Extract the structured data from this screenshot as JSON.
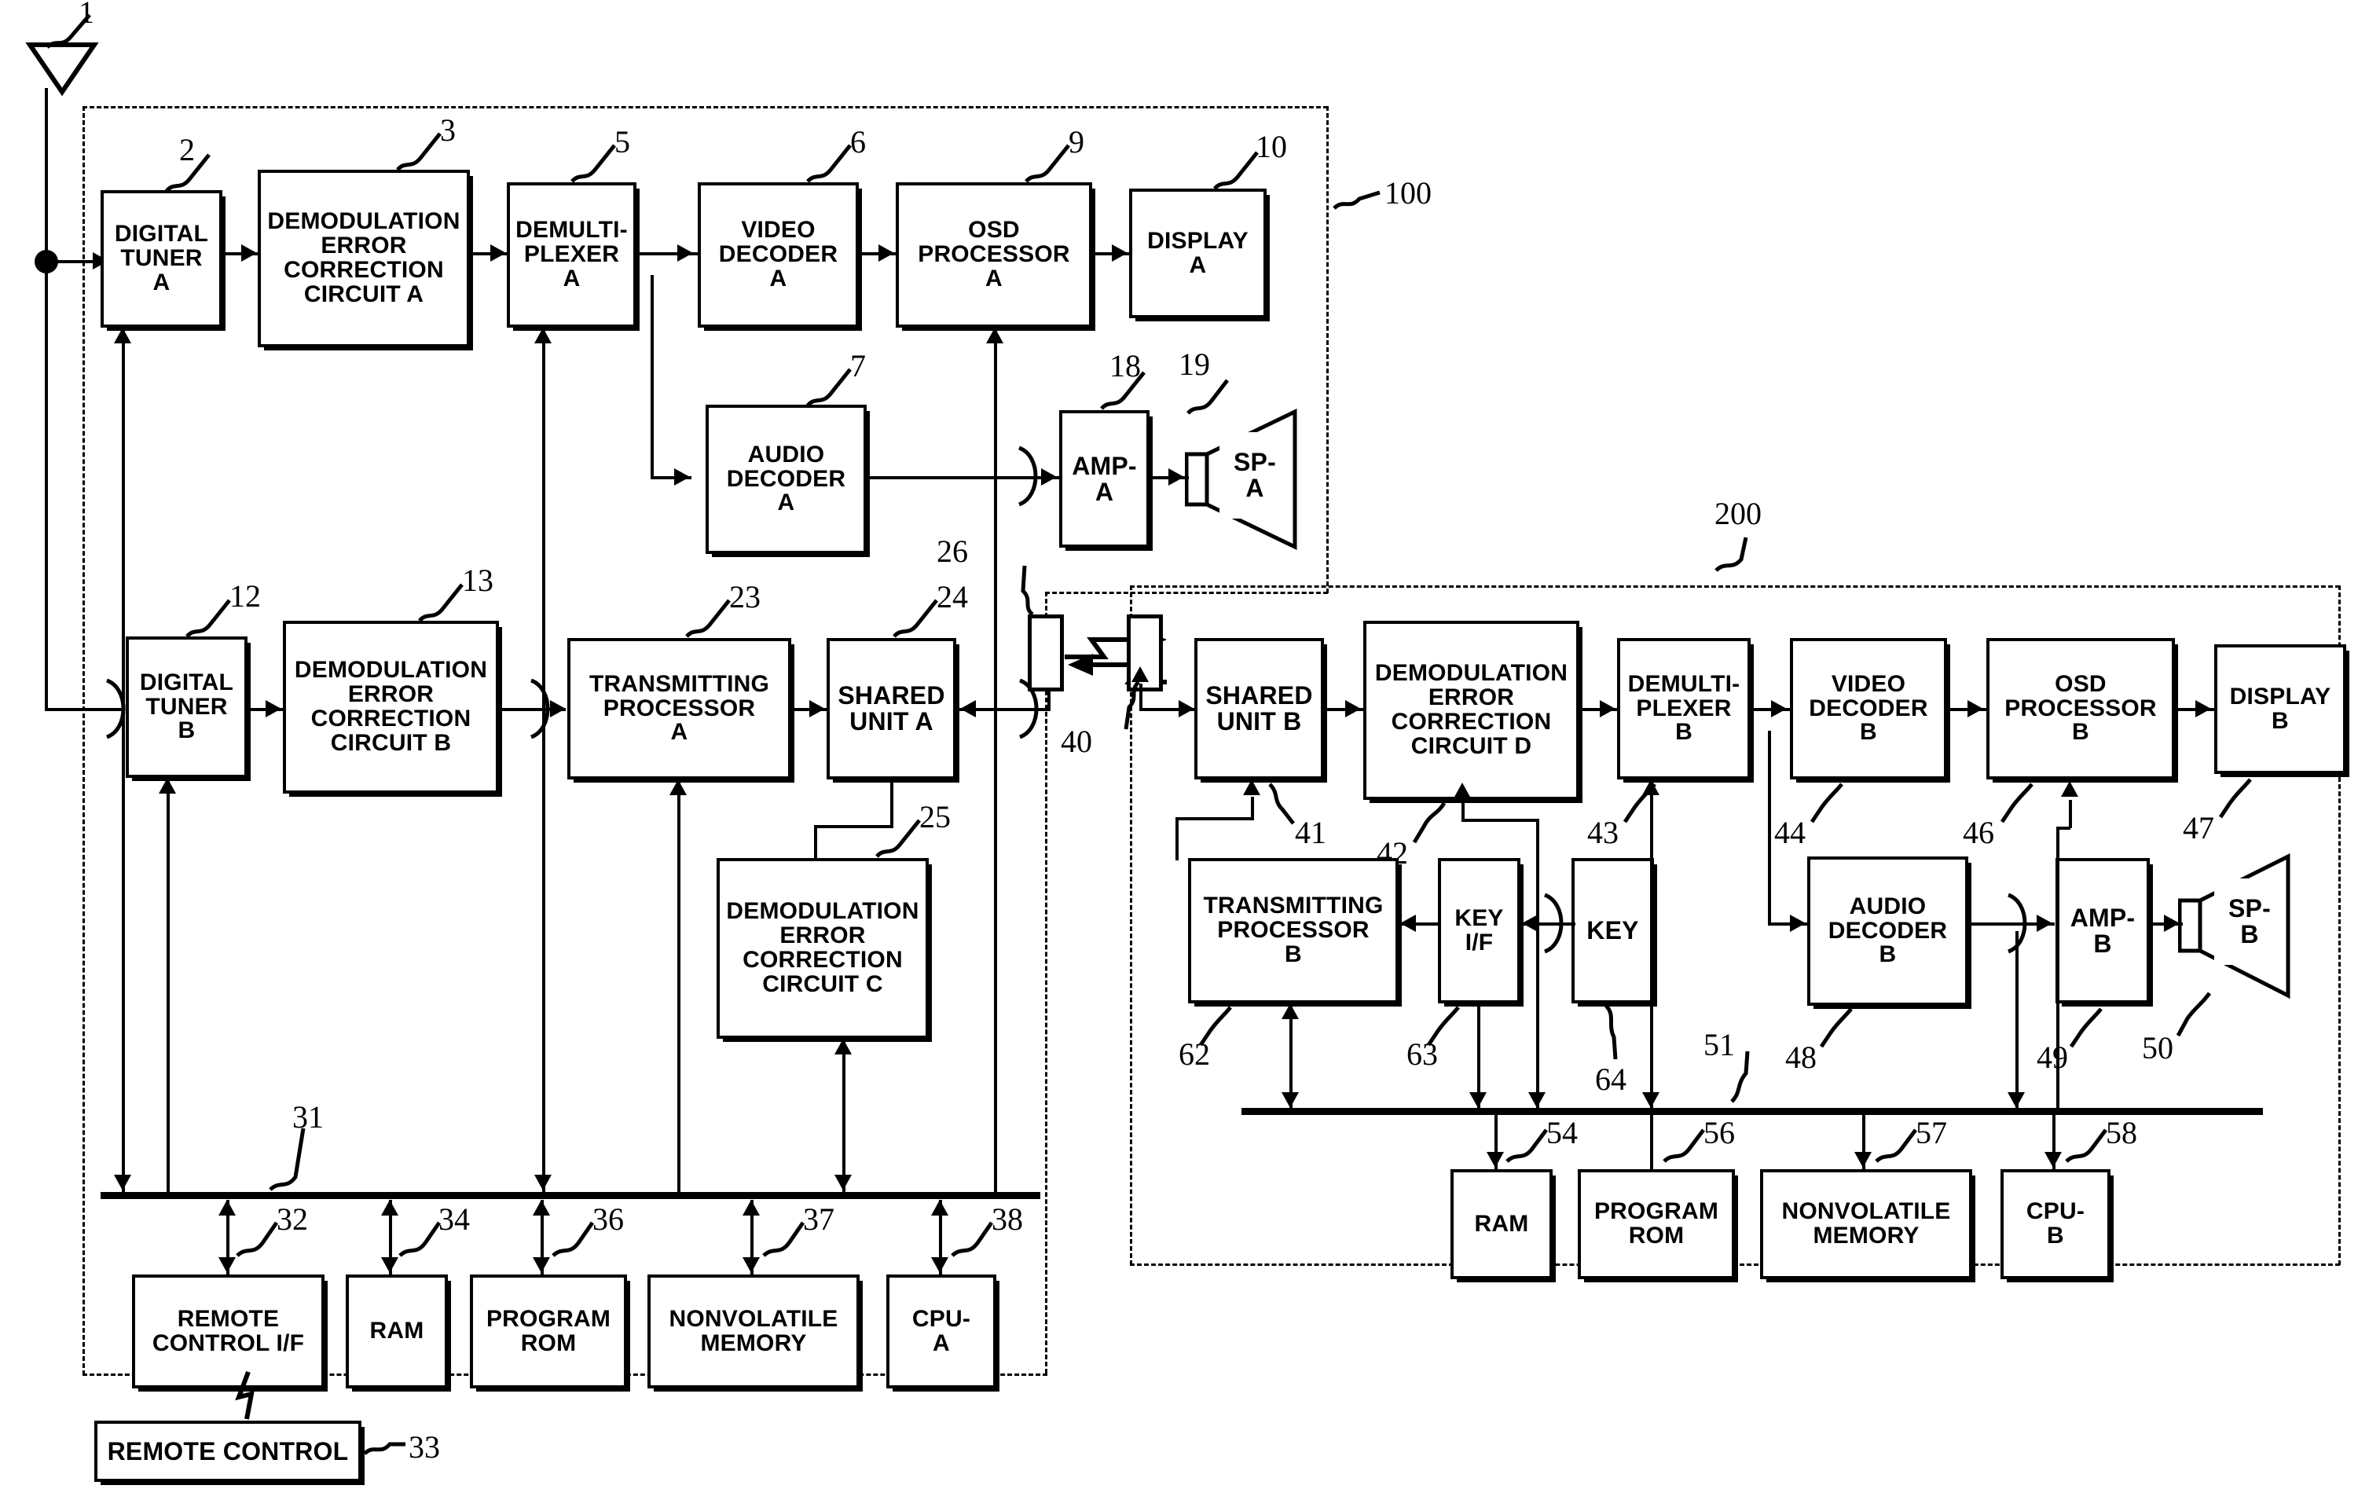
{
  "figure": {
    "type": "patent-block-diagram",
    "units": [
      {
        "ref": "100",
        "name": "main-unit"
      },
      {
        "ref": "200",
        "name": "sub-unit"
      }
    ]
  },
  "blocks": [
    {
      "id": "digital_tuner_a",
      "label": "DIGITAL\nTUNER\nA",
      "ref": "2"
    },
    {
      "id": "demod_a",
      "label": "DEMODULATION\nERROR\nCORRECTION\nCIRCUIT A",
      "ref": "3"
    },
    {
      "id": "demux_a",
      "label": "DEMULTI-\nPLEXER\nA",
      "ref": "5"
    },
    {
      "id": "video_decoder_a",
      "label": "VIDEO\nDECODER\nA",
      "ref": "6"
    },
    {
      "id": "osd_processor_a",
      "label": "OSD\nPROCESSOR\nA",
      "ref": "9"
    },
    {
      "id": "display_a",
      "label": "DISPLAY\nA",
      "ref": "10"
    },
    {
      "id": "audio_decoder_a",
      "label": "AUDIO\nDECODER\nA",
      "ref": "7"
    },
    {
      "id": "amp_a",
      "label": "AMP-\nA",
      "ref": "18"
    },
    {
      "id": "sp_a",
      "label": "SP-\nA",
      "ref": "19"
    },
    {
      "id": "digital_tuner_b",
      "label": "DIGITAL\nTUNER\nB",
      "ref": "12"
    },
    {
      "id": "demod_b",
      "label": "DEMODULATION\nERROR\nCORRECTION\nCIRCUIT B",
      "ref": "13"
    },
    {
      "id": "tx_processor_a",
      "label": "TRANSMITTING\nPROCESSOR\nA",
      "ref": "23"
    },
    {
      "id": "shared_unit_a",
      "label": "SHARED\nUNIT A",
      "ref": "24"
    },
    {
      "id": "demod_c",
      "label": "DEMODULATION\nERROR\nCORRECTION\nCIRCUIT C",
      "ref": "25"
    },
    {
      "id": "remote_control_if",
      "label": "REMOTE\nCONTROL I/F",
      "ref": "32"
    },
    {
      "id": "ram_a",
      "label": "RAM",
      "ref": "34"
    },
    {
      "id": "program_rom_a",
      "label": "PROGRAM\nROM",
      "ref": "36"
    },
    {
      "id": "nonvolatile_a",
      "label": "NONVOLATILE\nMEMORY",
      "ref": "37"
    },
    {
      "id": "cpu_a",
      "label": "CPU-\nA",
      "ref": "38"
    },
    {
      "id": "remote_control",
      "label": "REMOTE CONTROL",
      "ref": "33"
    },
    {
      "id": "shared_unit_b",
      "label": "SHARED\nUNIT B",
      "ref": "41"
    },
    {
      "id": "demod_d",
      "label": "DEMODULATION\nERROR\nCORRECTION\nCIRCUIT D",
      "ref": "42"
    },
    {
      "id": "demux_b",
      "label": "DEMULTI-\nPLEXER\nB",
      "ref": "43"
    },
    {
      "id": "video_decoder_b",
      "label": "VIDEO\nDECODER\nB",
      "ref": "44"
    },
    {
      "id": "osd_processor_b",
      "label": "OSD\nPROCESSOR\nB",
      "ref": "46"
    },
    {
      "id": "display_b",
      "label": "DISPLAY\nB",
      "ref": "47"
    },
    {
      "id": "tx_processor_b",
      "label": "TRANSMITTING\nPROCESSOR\nB",
      "ref": "62"
    },
    {
      "id": "key_if",
      "label": "KEY\nI/F",
      "ref": "63"
    },
    {
      "id": "key",
      "label": "KEY",
      "ref": "64"
    },
    {
      "id": "audio_decoder_b",
      "label": "AUDIO\nDECODER\nB",
      "ref": "48"
    },
    {
      "id": "amp_b",
      "label": "AMP-\nB",
      "ref": "49"
    },
    {
      "id": "sp_b",
      "label": "SP-\nB",
      "ref": "50"
    },
    {
      "id": "ram_b",
      "label": "RAM",
      "ref": "54"
    },
    {
      "id": "program_rom_b",
      "label": "PROGRAM\nROM",
      "ref": "56"
    },
    {
      "id": "nonvolatile_b",
      "label": "NONVOLATILE\nMEMORY",
      "ref": "57"
    },
    {
      "id": "cpu_b",
      "label": "CPU-\nB",
      "ref": "58"
    }
  ],
  "labels": {
    "digital_tuner_a": "DIGITAL TUNER A",
    "demod_a": "DEMODULATION ERROR CORRECTION CIRCUIT A",
    "demux_a": "DEMULTI- PLEXER A",
    "video_decoder_a": "VIDEO DECODER A",
    "osd_processor_a": "OSD PROCESSOR A",
    "display_a": "DISPLAY A",
    "audio_decoder_a": "AUDIO DECODER A",
    "amp_a": "AMP- A",
    "sp_a": "SP- A",
    "digital_tuner_b": "DIGITAL TUNER B",
    "demod_b": "DEMODULATION ERROR CORRECTION CIRCUIT B",
    "tx_processor_a": "TRANSMITTING PROCESSOR A",
    "shared_unit_a": "SHARED UNIT A",
    "demod_c": "DEMODULATION ERROR CORRECTION CIRCUIT C",
    "remote_control_if": "REMOTE CONTROL I/F",
    "ram_a": "RAM",
    "program_rom_a": "PROGRAM ROM",
    "nonvolatile_a": "NONVOLATILE MEMORY",
    "cpu_a": "CPU- A",
    "remote_control": "REMOTE CONTROL",
    "shared_unit_b": "SHARED UNIT B",
    "demod_d": "DEMODULATION ERROR CORRECTION CIRCUIT D",
    "demux_b": "DEMULTI- PLEXER B",
    "video_decoder_b": "VIDEO DECODER B",
    "osd_processor_b": "OSD PROCESSOR B",
    "display_b": "DISPLAY B",
    "tx_processor_b": "TRANSMITTING PROCESSOR B",
    "key_if": "KEY I/F",
    "key": "KEY",
    "audio_decoder_b": "AUDIO DECODER B",
    "amp_b": "AMP- B",
    "sp_b": "SP- B",
    "ram_b": "RAM",
    "program_rom_b": "PROGRAM ROM",
    "nonvolatile_b": "NONVOLATILE MEMORY",
    "cpu_b": "CPU- B"
  },
  "text": {
    "digital_tuner_a_1": "DIGITAL",
    "digital_tuner_a_2": "TUNER",
    "digital_tuner_a_3": "A",
    "demod_a_1": "DEMODULATION",
    "demod_a_2": "ERROR",
    "demod_a_3": "CORRECTION",
    "demod_a_4": "CIRCUIT A",
    "demux_a_1": "DEMULTI-",
    "demux_a_2": "PLEXER",
    "demux_a_3": "A",
    "video_decoder_a_1": "VIDEO",
    "video_decoder_a_2": "DECODER",
    "video_decoder_a_3": "A",
    "osd_processor_a_1": "OSD",
    "osd_processor_a_2": "PROCESSOR",
    "osd_processor_a_3": "A",
    "display_a_1": "DISPLAY",
    "display_a_2": "A",
    "audio_decoder_a_1": "AUDIO",
    "audio_decoder_a_2": "DECODER",
    "audio_decoder_a_3": "A",
    "amp_a_1": "AMP-",
    "amp_a_2": "A",
    "sp_a_1": "SP-",
    "sp_a_2": "A",
    "digital_tuner_b_1": "DIGITAL",
    "digital_tuner_b_2": "TUNER",
    "digital_tuner_b_3": "B",
    "demod_b_1": "DEMODULATION",
    "demod_b_2": "ERROR",
    "demod_b_3": "CORRECTION",
    "demod_b_4": "CIRCUIT B",
    "tx_processor_a_1": "TRANSMITTING",
    "tx_processor_a_2": "PROCESSOR",
    "tx_processor_a_3": "A",
    "shared_unit_a_1": "SHARED",
    "shared_unit_a_2": "UNIT A",
    "demod_c_1": "DEMODULATION",
    "demod_c_2": "ERROR",
    "demod_c_3": "CORRECTION",
    "demod_c_4": "CIRCUIT C",
    "remote_control_if_1": "REMOTE",
    "remote_control_if_2": "CONTROL I/F",
    "ram_a_1": "RAM",
    "program_rom_a_1": "PROGRAM",
    "program_rom_a_2": "ROM",
    "nonvolatile_a_1": "NONVOLATILE",
    "nonvolatile_a_2": "MEMORY",
    "cpu_a_1": "CPU-",
    "cpu_a_2": "A",
    "remote_control_1": "REMOTE CONTROL",
    "shared_unit_b_1": "SHARED",
    "shared_unit_b_2": "UNIT B",
    "demod_d_1": "DEMODULATION",
    "demod_d_2": "ERROR",
    "demod_d_3": "CORRECTION",
    "demod_d_4": "CIRCUIT D",
    "demux_b_1": "DEMULTI-",
    "demux_b_2": "PLEXER",
    "demux_b_3": "B",
    "video_decoder_b_1": "VIDEO",
    "video_decoder_b_2": "DECODER",
    "video_decoder_b_3": "B",
    "osd_processor_b_1": "OSD",
    "osd_processor_b_2": "PROCESSOR",
    "osd_processor_b_3": "B",
    "display_b_1": "DISPLAY",
    "display_b_2": "B",
    "tx_processor_b_1": "TRANSMITTING",
    "tx_processor_b_2": "PROCESSOR",
    "tx_processor_b_3": "B",
    "key_if_1": "KEY",
    "key_if_2": "I/F",
    "key_1": "KEY",
    "audio_decoder_b_1": "AUDIO",
    "audio_decoder_b_2": "DECODER",
    "audio_decoder_b_3": "B",
    "amp_b_1": "AMP-",
    "amp_b_2": "B",
    "sp_b_1": "SP-",
    "sp_b_2": "B",
    "ram_b_1": "RAM",
    "program_rom_b_1": "PROGRAM",
    "program_rom_b_2": "ROM",
    "nonvolatile_b_1": "NONVOLATILE",
    "nonvolatile_b_2": "MEMORY",
    "cpu_b_1": "CPU-",
    "cpu_b_2": "B"
  },
  "numerals": {
    "n1": "1",
    "n2": "2",
    "n3": "3",
    "n5": "5",
    "n6": "6",
    "n7": "7",
    "n9": "9",
    "n10": "10",
    "n12": "12",
    "n13": "13",
    "n18": "18",
    "n19": "19",
    "n23": "23",
    "n24": "24",
    "n25": "25",
    "n26": "26",
    "n31": "31",
    "n32": "32",
    "n33": "33",
    "n34": "34",
    "n36": "36",
    "n37": "37",
    "n38": "38",
    "n40": "40",
    "n41": "41",
    "n42": "42",
    "n43": "43",
    "n44": "44",
    "n46": "46",
    "n47": "47",
    "n48": "48",
    "n49": "49",
    "n50": "50",
    "n51": "51",
    "n54": "54",
    "n56": "56",
    "n57": "57",
    "n58": "58",
    "n62": "62",
    "n63": "63",
    "n64": "64",
    "n100": "100",
    "n200": "200"
  },
  "colors": {
    "line": "#000000",
    "background": "#ffffff"
  }
}
